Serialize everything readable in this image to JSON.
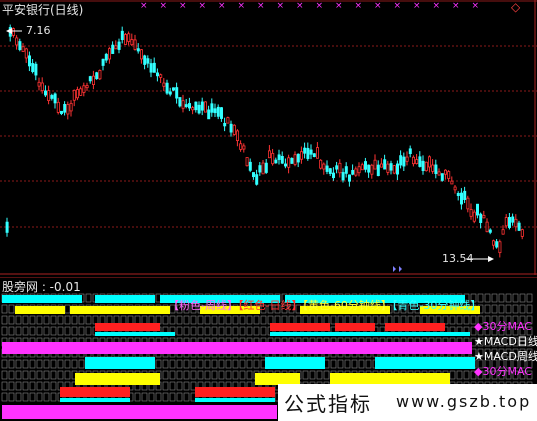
{
  "window": {
    "title": "平安银行(日线)",
    "lower_title": "股旁网 : -0.01"
  },
  "upper_markers": {
    "count": 18,
    "color": "#ff33ff"
  },
  "scroll_widget": {
    "label": "◇"
  },
  "price_labels": {
    "high": "7.16",
    "low": "13.54"
  },
  "legend": [
    {
      "text": "【粉色-周线】",
      "color": "#ff66ff"
    },
    {
      "text": "【红色-日线】",
      "color": "#ff3333"
    },
    {
      "text": "【黄色-60分钟线】",
      "color": "#ffff33"
    },
    {
      "text": "【青色-30分钟线】",
      "color": "#33ffff"
    }
  ],
  "side_labels": [
    {
      "text": "◆30分MAC",
      "color": "#ff33ff"
    },
    {
      "text": "★MACD日线",
      "color": "#ffffff"
    },
    {
      "text": "★MACD周线",
      "color": "#ffffff"
    },
    {
      "text": "◆30分MAC",
      "color": "#ff33ff"
    }
  ],
  "watermark": {
    "text_cn": "公式指标",
    "text_url": "www.gszb.top"
  },
  "colors": {
    "rise": "#ff3333",
    "fall": "#33ffff",
    "grid": "#8b1a1a",
    "pink": "#ff33ff",
    "red": "#ff2020",
    "yellow": "#ffff00",
    "cyan": "#00ffff",
    "white": "#ffffff"
  }
}
